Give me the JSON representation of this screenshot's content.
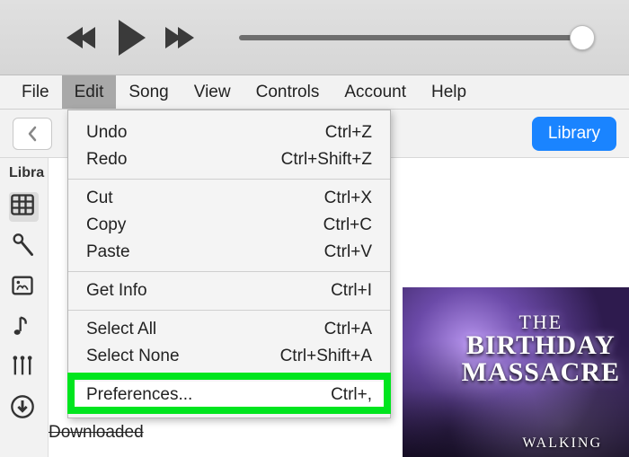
{
  "menubar": {
    "file": "File",
    "edit": "Edit",
    "song": "Song",
    "view": "View",
    "controls": "Controls",
    "account": "Account",
    "help": "Help"
  },
  "toolbar": {
    "library_label": "Library"
  },
  "sidebar": {
    "header": "Libra"
  },
  "dropdown": {
    "undo": {
      "label": "Undo",
      "shortcut": "Ctrl+Z"
    },
    "redo": {
      "label": "Redo",
      "shortcut": "Ctrl+Shift+Z"
    },
    "cut": {
      "label": "Cut",
      "shortcut": "Ctrl+X"
    },
    "copy": {
      "label": "Copy",
      "shortcut": "Ctrl+C"
    },
    "paste": {
      "label": "Paste",
      "shortcut": "Ctrl+V"
    },
    "getinfo": {
      "label": "Get Info",
      "shortcut": "Ctrl+I"
    },
    "selectall": {
      "label": "Select All",
      "shortcut": "Ctrl+A"
    },
    "selectnone": {
      "label": "Select None",
      "shortcut": "Ctrl+Shift+A"
    },
    "preferences": {
      "label": "Preferences...",
      "shortcut": "Ctrl+,"
    }
  },
  "album": {
    "line1": "THE",
    "line2": "BIRTHDAY",
    "line3": "MASSACRE",
    "sub": "WALKING"
  },
  "truncated": "Downloaded"
}
